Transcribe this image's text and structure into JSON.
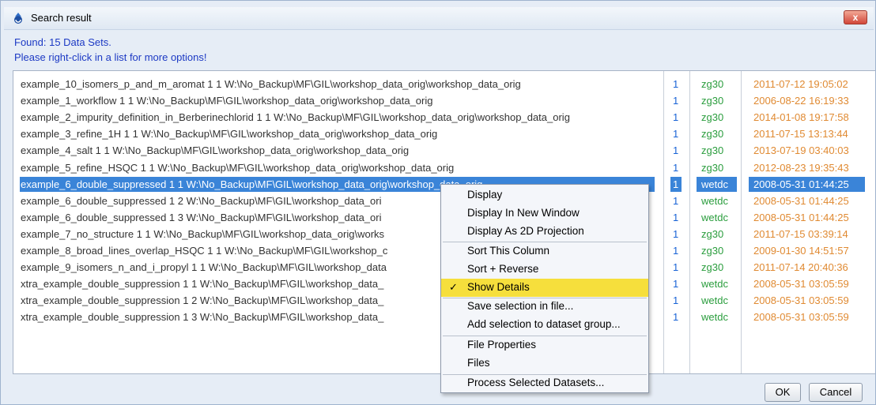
{
  "window": {
    "title": "Search result",
    "close_label": "x"
  },
  "info": {
    "found": "Found: 15 Data Sets.",
    "hint": "Please right-click in a list for more options!"
  },
  "rows": [
    {
      "name": "example_10_isomers_p_and_m_aromat  1  1  W:\\No_Backup\\MF\\GIL\\workshop_data_orig\\workshop_data_orig",
      "num": "1",
      "pp": "zg30",
      "date": "2011-07-12 19:05:02"
    },
    {
      "name": "example_1_workflow  1  1  W:\\No_Backup\\MF\\GIL\\workshop_data_orig\\workshop_data_orig",
      "num": "1",
      "pp": "zg30",
      "date": "2006-08-22 16:19:33"
    },
    {
      "name": "example_2_impurity_definition_in_Berberinechlorid  1  1  W:\\No_Backup\\MF\\GIL\\workshop_data_orig\\workshop_data_orig",
      "num": "1",
      "pp": "zg30",
      "date": "2014-01-08 19:17:58"
    },
    {
      "name": "example_3_refine_1H  1  1  W:\\No_Backup\\MF\\GIL\\workshop_data_orig\\workshop_data_orig",
      "num": "1",
      "pp": "zg30",
      "date": "2011-07-15 13:13:44"
    },
    {
      "name": "example_4_salt  1  1  W:\\No_Backup\\MF\\GIL\\workshop_data_orig\\workshop_data_orig",
      "num": "1",
      "pp": "zg30",
      "date": "2013-07-19 03:40:03"
    },
    {
      "name": "example_5_refine_HSQC  1  1  W:\\No_Backup\\MF\\GIL\\workshop_data_orig\\workshop_data_orig",
      "num": "1",
      "pp": "zg30",
      "date": "2012-08-23 19:35:43"
    },
    {
      "name": "example_6_double_suppressed  1  1  W:\\No_Backup\\MF\\GIL\\workshop_data_orig\\workshop_data_orig",
      "num": "1",
      "pp": "wetdc",
      "date": "2008-05-31 01:44:25"
    },
    {
      "name": "example_6_double_suppressed  1  2  W:\\No_Backup\\MF\\GIL\\workshop_data_ori",
      "num": "1",
      "pp": "wetdc",
      "date": "2008-05-31 01:44:25"
    },
    {
      "name": "example_6_double_suppressed  1  3  W:\\No_Backup\\MF\\GIL\\workshop_data_ori",
      "num": "1",
      "pp": "wetdc",
      "date": "2008-05-31 01:44:25"
    },
    {
      "name": "example_7_no_structure  1  1  W:\\No_Backup\\MF\\GIL\\workshop_data_orig\\works",
      "num": "1",
      "pp": "zg30",
      "date": "2011-07-15 03:39:14"
    },
    {
      "name": "example_8_broad_lines_overlap_HSQC  1  1  W:\\No_Backup\\MF\\GIL\\workshop_c",
      "num": "1",
      "pp": "zg30",
      "date": "2009-01-30 14:51:57"
    },
    {
      "name": "example_9_isomers_n_and_i_propyl  1  1  W:\\No_Backup\\MF\\GIL\\workshop_data",
      "num": "1",
      "pp": "zg30",
      "date": "2011-07-14 20:40:36"
    },
    {
      "name": "xtra_example_double_suppression  1  1  W:\\No_Backup\\MF\\GIL\\workshop_data_",
      "num": "1",
      "pp": "wetdc",
      "date": "2008-05-31 03:05:59"
    },
    {
      "name": "xtra_example_double_suppression  1  2  W:\\No_Backup\\MF\\GIL\\workshop_data_",
      "num": "1",
      "pp": "wetdc",
      "date": "2008-05-31 03:05:59"
    },
    {
      "name": "xtra_example_double_suppression  1  3  W:\\No_Backup\\MF\\GIL\\workshop_data_",
      "num": "1",
      "pp": "wetdc",
      "date": "2008-05-31 03:05:59"
    }
  ],
  "selected_row": 6,
  "context_menu": [
    {
      "label": "Display"
    },
    {
      "label": "Display In New Window"
    },
    {
      "label": "Display As 2D Projection"
    },
    {
      "label": "Sort This Column"
    },
    {
      "label": "Sort + Reverse"
    },
    {
      "label": "Show Details",
      "checked": true,
      "highlighted": true
    },
    {
      "label": "Save selection in file..."
    },
    {
      "label": "Add selection to dataset group..."
    },
    {
      "label": "File Properties"
    },
    {
      "label": "Files"
    },
    {
      "label": "Process Selected Datasets..."
    }
  ],
  "buttons": {
    "ok": "OK",
    "cancel": "Cancel"
  },
  "colors": {
    "accent_blue": "#1c39c4",
    "selection": "#3a84d8",
    "menu_highlight": "#f6df3c",
    "pulprog_green": "#2a9d3d",
    "date_orange": "#e08a32"
  },
  "icons": {
    "app": "bruker-topspin-icon",
    "check": "checkmark-icon",
    "close": "close-icon"
  }
}
